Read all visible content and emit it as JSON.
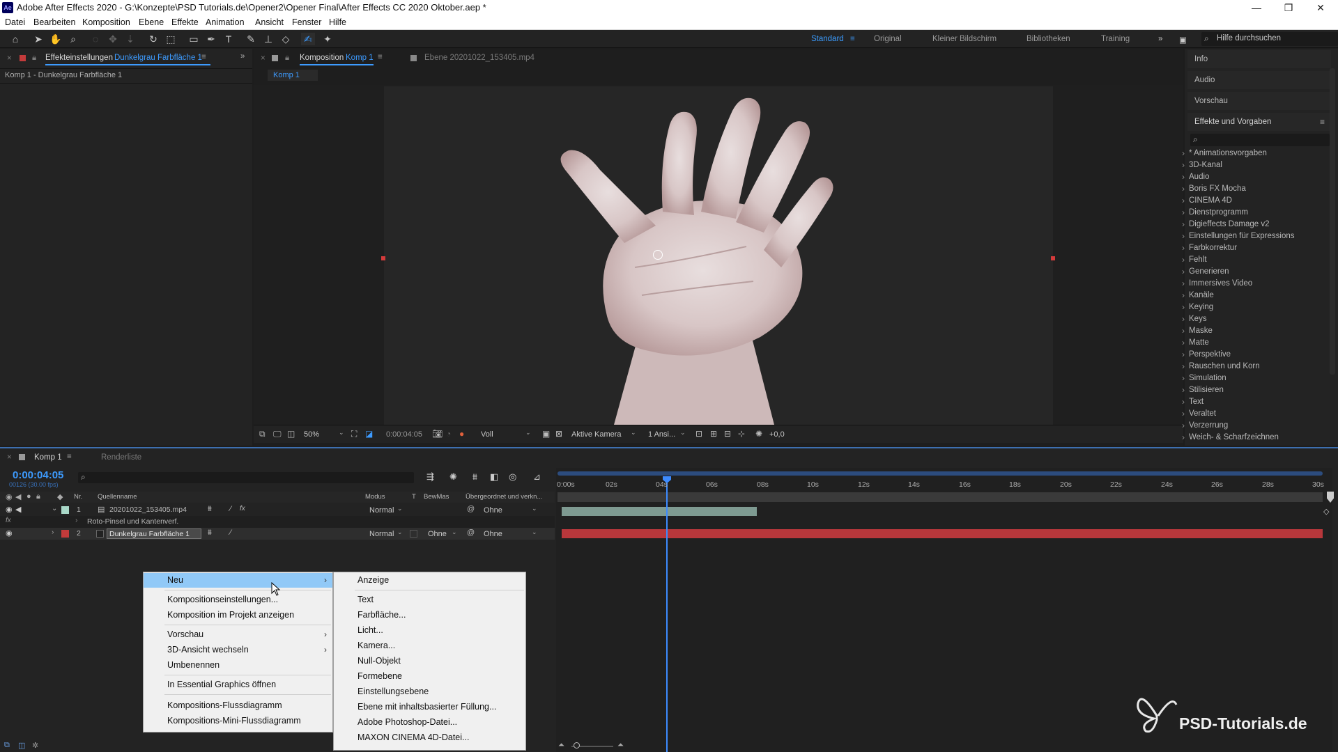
{
  "app": {
    "title": "Adobe After Effects 2020 - G:\\Konzepte\\PSD Tutorials.de\\Opener2\\Opener Final\\After Effects CC 2020 Oktober.aep *",
    "logo_text": "Ae"
  },
  "menubar": [
    "Datei",
    "Bearbeiten",
    "Komposition",
    "Ebene",
    "Effekte",
    "Animation",
    "Ansicht",
    "Fenster",
    "Hilfe"
  ],
  "workspaces": {
    "items": [
      "Standard",
      "Original",
      "Kleiner Bildschirm",
      "Bibliotheken",
      "Training"
    ],
    "active": "Standard",
    "more": "»",
    "help_search_placeholder": "Hilfe durchsuchen"
  },
  "effects_panel": {
    "tab_label": "Effekteinstellungen",
    "tab_layer": "Dunkelgrau Farbfläche 1",
    "breadcrumb": "Komp 1 - Dunkelgrau Farbfläche 1"
  },
  "comp_panel": {
    "tab_label": "Komposition",
    "tab_comp": "Komp 1",
    "layer_tab": "Ebene 20201022_153405.mp4",
    "subtab": "Komp 1",
    "footer": {
      "zoom": "50%",
      "timecode": "0:00:04:05",
      "resolution": "Voll",
      "camera": "Aktive Kamera",
      "views": "1 Ansi...",
      "exposure": "+0,0"
    }
  },
  "right_panels": {
    "info": "Info",
    "audio": "Audio",
    "vorschau": "Vorschau",
    "effects_title": "Effekte und Vorgaben",
    "effects_list": [
      "* Animationsvorgaben",
      "3D-Kanal",
      "Audio",
      "Boris FX Mocha",
      "CINEMA 4D",
      "Dienstprogramm",
      "Digieffects Damage v2",
      "Einstellungen für Expressions",
      "Farbkorrektur",
      "Fehlt",
      "Generieren",
      "Immersives Video",
      "Kanäle",
      "Keying",
      "Keys",
      "Maske",
      "Matte",
      "Perspektive",
      "Rauschen und Korn",
      "Simulation",
      "Stilisieren",
      "Text",
      "Veraltet",
      "Verzerrung",
      "Weich- & Scharfzeichnen"
    ]
  },
  "timeline": {
    "tab_comp": "Komp 1",
    "tab_render": "Renderliste",
    "timecode": "0:00:04:05",
    "frames": "00126 (30.00 fps)",
    "columns": {
      "nr": "Nr.",
      "source": "Quellenname",
      "mode": "Modus",
      "t": "T",
      "trkmat": "BewMas",
      "parent": "Übergeordnet und verkn..."
    },
    "ruler": [
      "0:00s",
      "02s",
      "04s",
      "06s",
      "08s",
      "10s",
      "12s",
      "14s",
      "16s",
      "18s",
      "20s",
      "22s",
      "24s",
      "26s",
      "28s",
      "30s"
    ],
    "layers": [
      {
        "nr": "1",
        "name": "20201022_153405.mp4",
        "mode": "Normal",
        "trkmat": "",
        "parent": "Ohne",
        "color": "#a9d8c8"
      },
      {
        "nr": "2",
        "name": "Dunkelgrau Farbfläche 1",
        "mode": "Normal",
        "trkmat": "Ohne",
        "parent": "Ohne",
        "color": "#c23b3b"
      }
    ],
    "effect_row": "Roto-Pinsel und Kantenverf.",
    "fx_label": "fx"
  },
  "context_menu": {
    "items": [
      {
        "label": "Neu",
        "submenu": true
      },
      {
        "label": "Kompositionseinstellungen..."
      },
      {
        "label": "Komposition im Projekt anzeigen"
      },
      {
        "label": "Vorschau",
        "submenu": true
      },
      {
        "label": "3D-Ansicht wechseln",
        "submenu": true
      },
      {
        "label": "Umbenennen"
      },
      {
        "label": "In Essential Graphics öffnen"
      },
      {
        "label": "Kompositions-Flussdiagramm"
      },
      {
        "label": "Kompositions-Mini-Flussdiagramm"
      }
    ],
    "submenu": [
      "Anzeige",
      "Text",
      "Farbfläche...",
      "Licht...",
      "Kamera...",
      "Null-Objekt",
      "Formebene",
      "Einstellungsebene",
      "Ebene mit inhaltsbasierter Füllung...",
      "Adobe Photoshop-Datei...",
      "MAXON CINEMA 4D-Datei..."
    ]
  },
  "watermark": "PSD-Tutorials.de",
  "colors": {
    "accent": "#3d9bff",
    "layer_bar_red": "#b8373b",
    "layer_bar_green": "#7e9a91",
    "menu_highlight": "#91c9f7"
  }
}
